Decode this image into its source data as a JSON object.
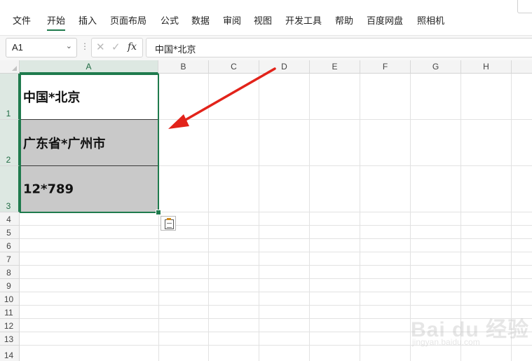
{
  "menu": {
    "items": [
      "文件",
      "开始",
      "插入",
      "页面布局",
      "公式",
      "数据",
      "审阅",
      "视图",
      "开发工具",
      "帮助",
      "百度网盘",
      "照相机"
    ],
    "active": "开始"
  },
  "formula_bar": {
    "name_box": "A1",
    "cancel_glyph": "✕",
    "confirm_glyph": "✓",
    "fx_label": "fx",
    "content": "中国*北京"
  },
  "sheet": {
    "columns": [
      "A",
      "B",
      "C",
      "D",
      "E",
      "F",
      "G",
      "H"
    ],
    "rows": [
      "1",
      "2",
      "3",
      "4",
      "5",
      "6",
      "7",
      "8",
      "9",
      "10",
      "11",
      "12",
      "13",
      "14"
    ],
    "selected_column": "A",
    "selected_rows": [
      "1",
      "2",
      "3"
    ],
    "cells": {
      "A1": "中国*北京",
      "A2": "广东省*广州市",
      "A3": "12*789"
    }
  },
  "colors": {
    "accent": "#1f7b4d",
    "cell_shade": "#c9c9c9",
    "arrow": "#e2231a"
  },
  "icons": [
    "dropdown-chevron-icon",
    "cancel-icon",
    "confirm-icon",
    "function-icon",
    "paste-options-icon"
  ],
  "watermark": {
    "main": "Bai du 经验",
    "sub": "jingyan.baidu.com"
  }
}
